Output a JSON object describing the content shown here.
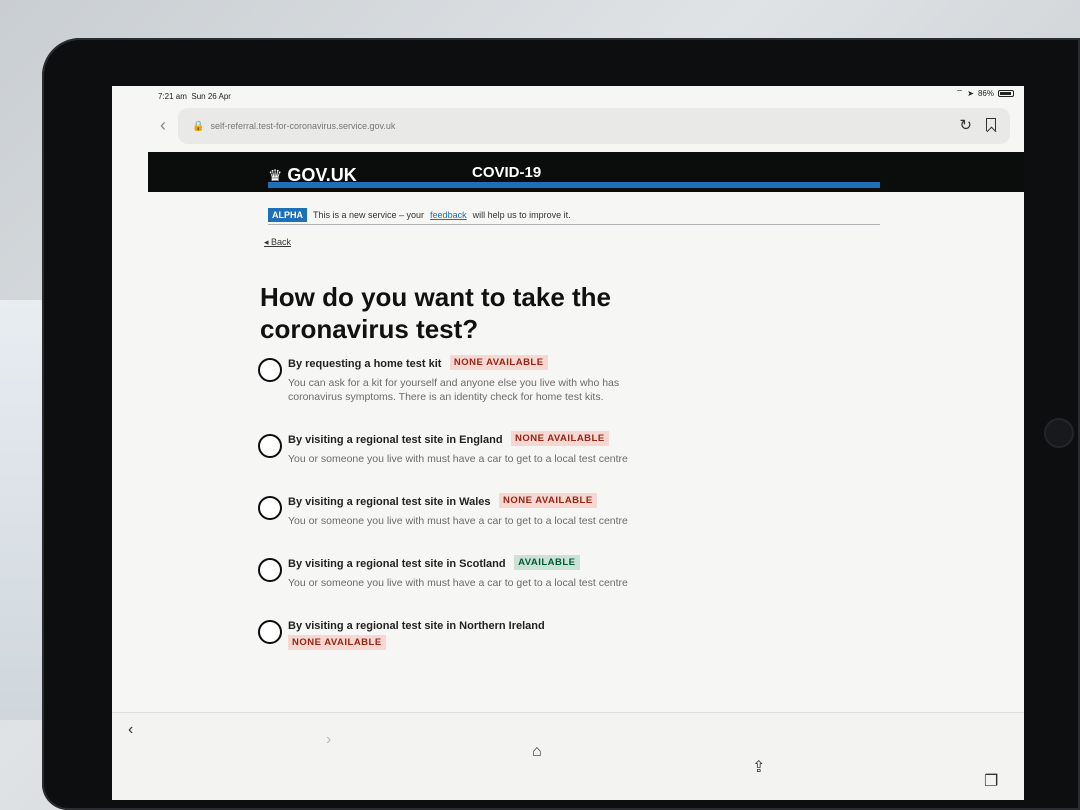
{
  "status": {
    "time": "7:21 am",
    "date": "Sun 26 Apr",
    "battery": "86%"
  },
  "browser": {
    "url": "self-referral.test-for-coronavirus.service.gov.uk"
  },
  "header": {
    "logo": "GOV.UK",
    "service": "COVID-19"
  },
  "banner": {
    "tag": "ALPHA",
    "text_before": "This is a new service – your",
    "link": "feedback",
    "text_after": "will help us to improve it."
  },
  "back_label": "Back",
  "heading": "How do you want to take the coronavirus test?",
  "options": [
    {
      "label": "By requesting a home test kit",
      "tag": "NONE AVAILABLE",
      "hint": "You can ask for a kit for yourself and anyone else you live with who has coronavirus symptoms. There is an identity check for home test kits."
    },
    {
      "label": "By visiting a regional test site in England",
      "tag": "NONE AVAILABLE",
      "hint": "You or someone you live with must have a car to get to a local test centre"
    },
    {
      "label": "By visiting a regional test site in Wales",
      "tag": "NONE AVAILABLE",
      "hint": "You or someone you live with must have a car to get to a local test centre"
    },
    {
      "label": "By visiting a regional test site in Scotland",
      "tag": "AVAILABLE",
      "hint": "You or someone you live with must have a car to get to a local test centre"
    },
    {
      "label": "By visiting a regional test site in Northern Ireland",
      "tag": "NONE AVAILABLE",
      "hint": ""
    }
  ],
  "icons": {
    "back": "chevron-left-icon",
    "forward": "chevron-right-icon",
    "home": "home-icon",
    "share": "share-icon",
    "tabs": "tabs-icon"
  },
  "colors": {
    "gov_black": "#0b0c0c",
    "gov_blue": "#1d70b8",
    "tag_red_bg": "#f6d7d2",
    "tag_green_bg": "#cce2d8"
  }
}
